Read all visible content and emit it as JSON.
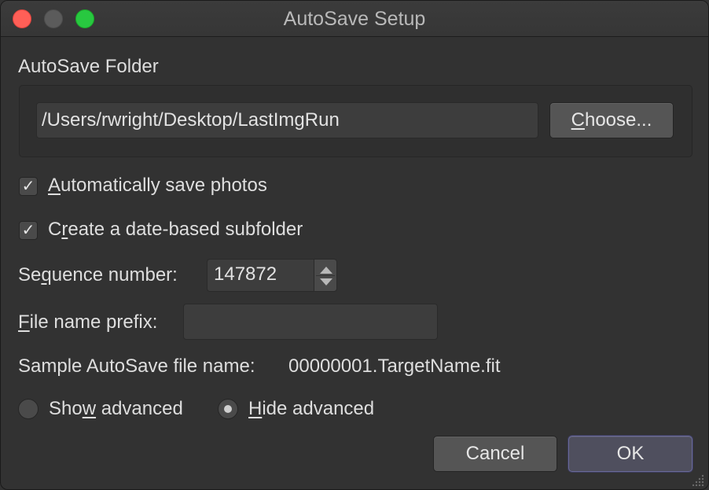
{
  "window": {
    "title": "AutoSave Setup"
  },
  "folder_group": {
    "label": "AutoSave Folder",
    "path_value": "/Users/rwright/Desktop/LastImgRun",
    "choose_button": {
      "pre": "",
      "ul": "C",
      "post": "hoose..."
    }
  },
  "options": {
    "auto_save": {
      "checked": true,
      "pre": "",
      "ul": "A",
      "post": "utomatically save photos",
      "check_glyph": "✓"
    },
    "date_subfolder": {
      "checked": true,
      "pre": "C",
      "ul": "r",
      "post": "eate a date-based subfolder",
      "check_glyph": "✓"
    }
  },
  "sequence": {
    "label": {
      "pre": "Se",
      "ul": "q",
      "post": "uence number:"
    },
    "value": "147872"
  },
  "prefix": {
    "label": {
      "pre": "",
      "ul": "F",
      "post": "ile name prefix:"
    },
    "value": ""
  },
  "sample": {
    "label": "Sample AutoSave file name:",
    "value": "00000001.TargetName.fit"
  },
  "advanced": {
    "show": {
      "selected": false,
      "pre": "Sho",
      "ul": "w",
      "post": " advanced"
    },
    "hide": {
      "selected": true,
      "pre": "",
      "ul": "H",
      "post": "ide advanced"
    }
  },
  "buttons": {
    "cancel": "Cancel",
    "ok": "OK"
  }
}
